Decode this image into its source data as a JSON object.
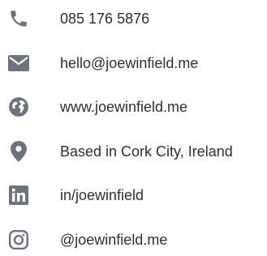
{
  "accent_color": "#6b7280",
  "contacts": [
    {
      "icon": "phone-icon",
      "text": "085 176 5876"
    },
    {
      "icon": "mail-icon",
      "text": "hello@joewinfield.me"
    },
    {
      "icon": "globe-icon",
      "text": "www.joewinfield.me"
    },
    {
      "icon": "location-pin-icon",
      "text": "Based in Cork City, Ireland"
    },
    {
      "icon": "linkedin-icon",
      "text": "in/joewinfield"
    },
    {
      "icon": "instagram-icon",
      "text": "@joewinfield.me"
    }
  ]
}
